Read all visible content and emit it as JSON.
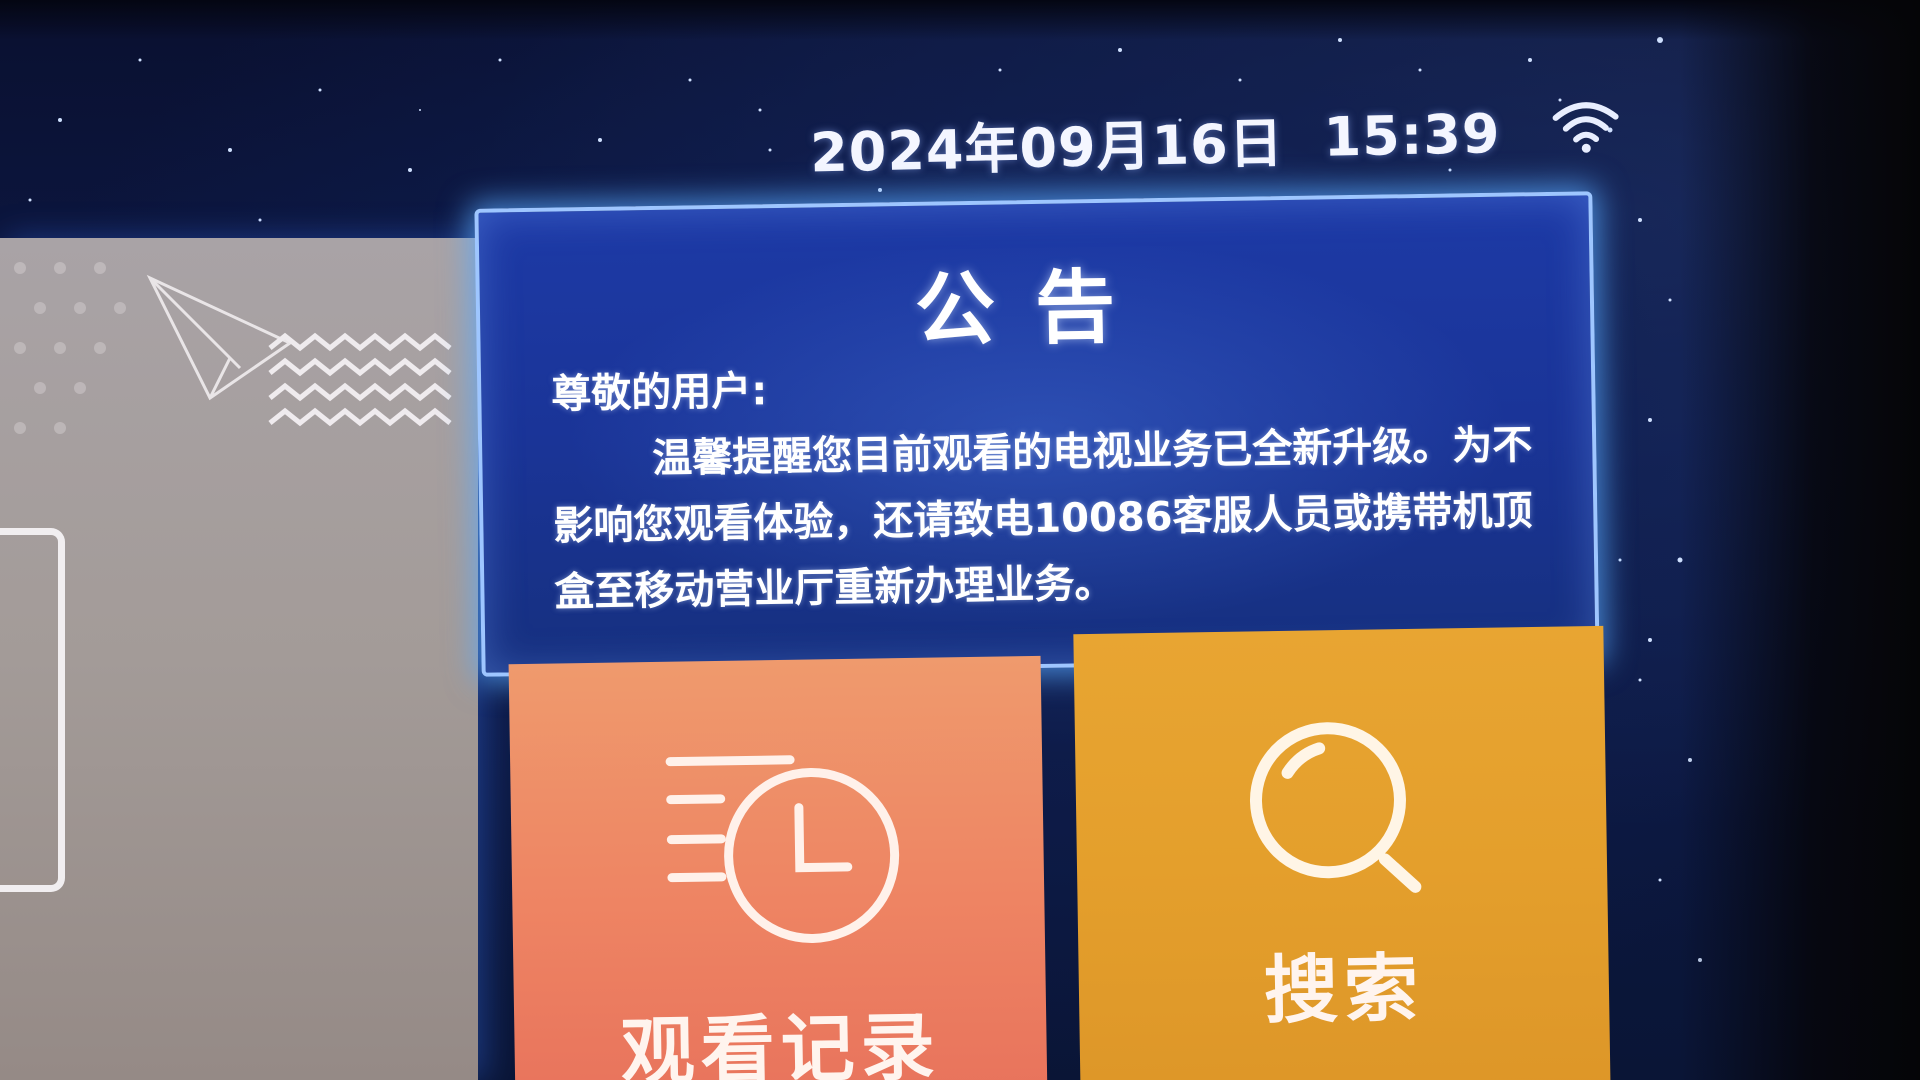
{
  "status_bar": {
    "date": "2024年09月16日",
    "time": "15:39",
    "wifi_icon": "wifi-icon"
  },
  "announcement": {
    "title": "公告",
    "greeting": "尊敬的用户:",
    "paragraph": "温馨提醒您目前观看的电视业务已全新升级。为不影响您观看体验，还请致电10086客服人员或携带机顶盒至移动营业厅重新办理业务。"
  },
  "tiles": {
    "history": {
      "label": "观看记录",
      "icon": "clock-history-icon",
      "color": "#ee8463"
    },
    "search": {
      "label": "搜索",
      "icon": "search-icon",
      "color": "#e4a02c"
    }
  },
  "colors": {
    "background": "#0d1a48",
    "announcement_bg": "#1a3497",
    "announcement_glow": "#9ec6ff"
  }
}
